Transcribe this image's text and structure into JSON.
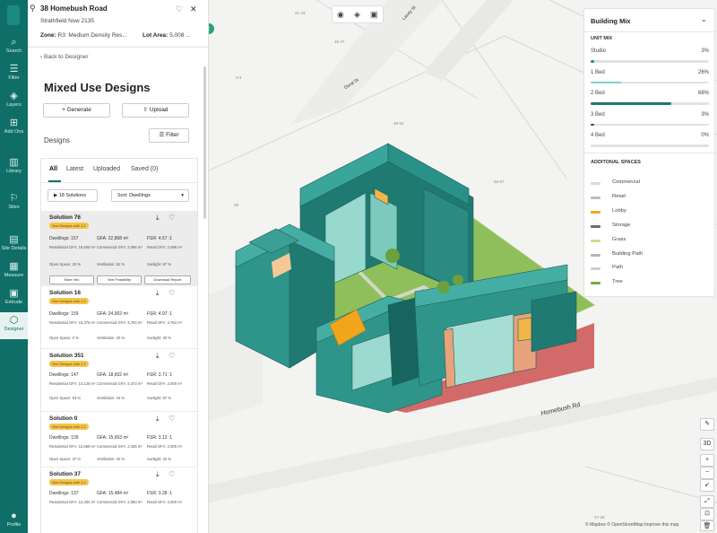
{
  "rail": {
    "items": [
      {
        "label": "Search",
        "icon": "search-icon"
      },
      {
        "label": "Filter",
        "icon": "filter-icon"
      },
      {
        "label": "Layers",
        "icon": "layers-icon"
      },
      {
        "label": "Add Ons",
        "icon": "add-ons-icon"
      },
      {
        "label": "Library",
        "icon": "library-icon"
      },
      {
        "label": "Sites",
        "icon": "sites-icon"
      },
      {
        "label": "Site Details",
        "icon": "site-details-icon"
      },
      {
        "label": "Measure",
        "icon": "measure-icon"
      },
      {
        "label": "Extrude",
        "icon": "extrude-icon"
      },
      {
        "label": "Designer",
        "icon": "designer-icon"
      }
    ],
    "profile_label": "Profile"
  },
  "site": {
    "address": "38 Homebush Road",
    "suburb": "Strathfield Nsw 2135",
    "zone_label": "Zone:",
    "zone_value": "R3: Medium Density Res...",
    "lot_label": "Lot Area:",
    "lot_value": "5,008 ..."
  },
  "designer": {
    "back_label": "Back to Designer",
    "title": "Mixed Use Designs",
    "generate_label": "Generate",
    "upload_label": "Upload",
    "section_label": "Designs",
    "filter_label": "Filter",
    "tabs": [
      "All",
      "Latest",
      "Uploaded",
      "Saved (0)"
    ],
    "solutions_toggle": "18 Solutions",
    "sort_label": "Sort:",
    "sort_value": "Dwellings"
  },
  "solutions": [
    {
      "name": "Solution 76",
      "badge": "See Designs with 1.2",
      "dwellings": "Dwellings: 157",
      "gfa": "GFA: 22,868 m²",
      "fsr": "FSR: 4.57 :1",
      "residential": "Residential GFA: 16,606 m²",
      "commercial": "Commercial GFA: 2,096 m²",
      "retail": "Retail GFA: 2,096 m²",
      "open_space": "Open Space: 20 %",
      "ventilation": "Ventilation: 62 %",
      "sunlight": "Sunlight: 67 %",
      "actions": [
        "More Info",
        "See Feasibility",
        "Download Report"
      ]
    },
    {
      "name": "Solution 16",
      "badge": "See Designs with 1.2",
      "dwellings": "Dwellings: 159",
      "gfa": "GFA: 24,902 m²",
      "fsr": "FSR: 4.97 :1",
      "residential": "Residential GFA: 15,376 m²",
      "commercial": "Commercial GFA: 4,764 m²",
      "retail": "Retail GFA: 4,764 m²",
      "open_space": "Open Space: 0 %",
      "ventilation": "Ventilation: 20 %",
      "sunlight": "Sunlight: 40 %"
    },
    {
      "name": "Solution 351",
      "badge": "See Designs with 1.2",
      "dwellings": "Dwellings: 147",
      "gfa": "GFA: 18,602 m²",
      "fsr": "FSR: 3.71 :1",
      "residential": "Residential GFA: 14,126 m²",
      "commercial": "Commercial GFA: 2,473 m²",
      "retail": "Retail GFA: 2,000 m²",
      "open_space": "Open Space: 53 %",
      "ventilation": "Ventilation: 44 %",
      "sunlight": "Sunlight: 87 %"
    },
    {
      "name": "Solution 0",
      "badge": "See Designs with 1.2",
      "dwellings": "Dwellings: 139",
      "gfa": "GFA: 15,653 m²",
      "fsr": "FSR: 3.12 :1",
      "residential": "Residential GFA: 12,668 m²",
      "commercial": "Commercial GFA: 2,185 m²",
      "retail": "Retail GFA: 2,000 m²",
      "open_space": "Open Space: 37 %",
      "ventilation": "Ventilation: 40 %",
      "sunlight": "Sunlight: 42 %"
    },
    {
      "name": "Solution 37",
      "badge": "See Designs with 1.2",
      "dwellings": "Dwellings: 137",
      "gfa": "GFA: 15,484 m²",
      "fsr": "FSR: 3.28 :1",
      "residential": "Residential GFA: 12,384 m²",
      "commercial": "Commercial GFA: 2,060 m²",
      "retail": "Retail GFA: 2,000 m²",
      "open_space": "",
      "ventilation": "",
      "sunlight": ""
    }
  ],
  "map": {
    "streets": {
      "dural": "Dural St",
      "homebush": "Homebush Rd",
      "lacey": "Lacey St"
    },
    "lot_numbers": [
      "41-43",
      "45-47",
      "2-4",
      "49-53",
      "55-57",
      "28",
      "27-29"
    ],
    "attribution": "© Mapbox © OpenStreetMap  Improve this map",
    "controls": [
      "3D",
      "+",
      "−"
    ]
  },
  "building_mix": {
    "title": "Building Mix",
    "unit_mix_label": "UNIT MIX",
    "units": [
      {
        "label": "Studio",
        "pct_text": "3%",
        "fraction": 0.03,
        "color": "#2a8a7a"
      },
      {
        "label": "1 Bed",
        "pct_text": "26%",
        "fraction": 0.26,
        "color": "#7fd3c8"
      },
      {
        "label": "2 Bed",
        "pct_text": "68%",
        "fraction": 0.68,
        "color": "#1f7a6a"
      },
      {
        "label": "3 Bed",
        "pct_text": "3%",
        "fraction": 0.03,
        "color": "#1f5a55"
      },
      {
        "label": "4 Bed",
        "pct_text": "0%",
        "fraction": 0.0,
        "color": "#1f5a55"
      }
    ],
    "spaces_label": "ADDITONAL SPACES",
    "spaces": [
      {
        "label": "Commercial",
        "color": "#d9d9d9"
      },
      {
        "label": "Retail",
        "color": "#bdbdbd"
      },
      {
        "label": "Lobby",
        "color": "#f2a51b"
      },
      {
        "label": "Storage",
        "color": "#6b6b6b"
      },
      {
        "label": "Grass",
        "color": "#c8e08a"
      },
      {
        "label": "Building Path",
        "color": "#b5b5b5"
      },
      {
        "label": "Path",
        "color": "#cfcfcf"
      },
      {
        "label": "Tree",
        "color": "#7aa84a"
      }
    ]
  }
}
